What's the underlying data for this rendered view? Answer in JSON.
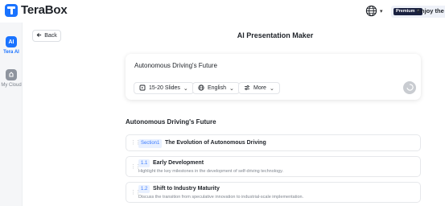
{
  "app": {
    "name": "TeraBox"
  },
  "header": {
    "premium_badge": "Premium ✦",
    "enjoy_text": "Enjoy the AI"
  },
  "sidebar": {
    "items": [
      {
        "label": "Tera AI"
      },
      {
        "label": "My Cloud"
      }
    ]
  },
  "back": {
    "label": "Back"
  },
  "page": {
    "title": "AI Presentation Maker"
  },
  "prompt": {
    "text": "Autonomous Driving's Future",
    "chips": [
      {
        "label": "15-20 Slides"
      },
      {
        "label": "English"
      },
      {
        "label": "More"
      }
    ]
  },
  "outline": {
    "title": "Autonomous Driving's Future",
    "section": {
      "badge": "Section1",
      "title": "The Evolution of Autonomous Driving"
    },
    "items": [
      {
        "num": "1.1",
        "title": "Early Development",
        "desc": "Highlight the key milestones in the development of self-driving technology."
      },
      {
        "num": "1.2",
        "title": "Shift to Industry Maturity",
        "desc": "Discuss the transition from speculative innovation to industrial-scale implementation."
      }
    ]
  },
  "colors": {
    "accent": "#1a73ff",
    "badge_bg": "#e8f0ff",
    "badge_text": "#3a7bff"
  }
}
